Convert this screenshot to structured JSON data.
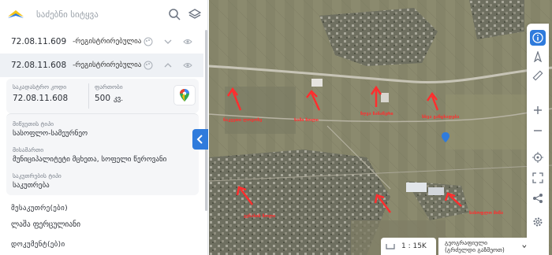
{
  "search": {
    "placeholder": "საძებნი სიტყვა"
  },
  "parcels": [
    {
      "code": "72.08.11.609",
      "status": "-რეგისტრირებულია"
    },
    {
      "code": "72.08.11.608",
      "status": "-რეგისტრირებულია"
    }
  ],
  "details": {
    "cadastral_label": "საკადასტრო კოდი",
    "cadastral_value": "72.08.11.608",
    "area_label": "ფართობი",
    "area_value": "500",
    "area_unit": "კვ.",
    "land_type_label": "მიწვეთის ტიპი",
    "land_type_value": "სასოფლო-სამეურნეო",
    "location_label": "მისამართი",
    "location_value": "მუნიციპალიტეტი მცხეთა, სოფელი წეროვანი",
    "ownership_label": "საკუთრების ტიპი",
    "ownership_value": "საკუთრება"
  },
  "owners": {
    "title": "მესაკუთრე(ები)",
    "value": "ლაშა ფერცულიანი"
  },
  "documents": {
    "title": "დოკუმენტ(ებ)ი"
  },
  "map": {
    "scale": "1 : 15K",
    "basemap": "გეოგრაფიული (გრძელდი გაზმეოთ)"
  },
  "annotations": [
    "ნაკვეთი ლოგოზე",
    "სამი ზოლი",
    "ზღვა ჩანაწერი",
    "სხვა განცხადება",
    "ვენახის ზოლი",
    "სასოფლო მიწა"
  ],
  "colors": {
    "accent": "#2f7bdc",
    "annotation": "#ff2e2e",
    "google_maps": "#34a853"
  }
}
